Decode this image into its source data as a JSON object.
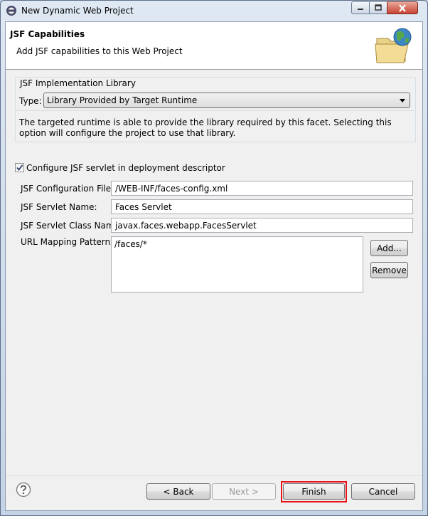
{
  "window": {
    "title": "New Dynamic Web Project",
    "controls": [
      "minimize",
      "maximize",
      "close"
    ]
  },
  "header": {
    "title": "JSF Capabilities",
    "description": "Add JSF capabilities to this Web Project",
    "banner_icon": "folder-globe-icon"
  },
  "implementation_group": {
    "label": "JSF Implementation Library",
    "type_label": "Type:",
    "type_value": "Library Provided by Target Runtime",
    "info_text": "The targeted runtime is able to provide the library required by this facet. Selecting this option will configure the project to use that library."
  },
  "configure": {
    "checkbox_label": "Configure JSF servlet in deployment descriptor",
    "checked": true
  },
  "fields": {
    "config_file_label": "JSF Configuration File:",
    "config_file_value": "/WEB-INF/faces-config.xml",
    "servlet_name_label": "JSF Servlet Name:",
    "servlet_name_value": "Faces Servlet",
    "servlet_class_label": "JSF Servlet Class Name:",
    "servlet_class_value": "javax.faces.webapp.FacesServlet",
    "url_mapping_label": "URL Mapping Patterns:",
    "url_mapping_value": "/faces/*"
  },
  "buttons": {
    "add": "Add...",
    "remove": "Remove",
    "back": "< Back",
    "next": "Next >",
    "finish": "Finish",
    "cancel": "Cancel"
  },
  "colors": {
    "highlight": "#e8141a"
  }
}
